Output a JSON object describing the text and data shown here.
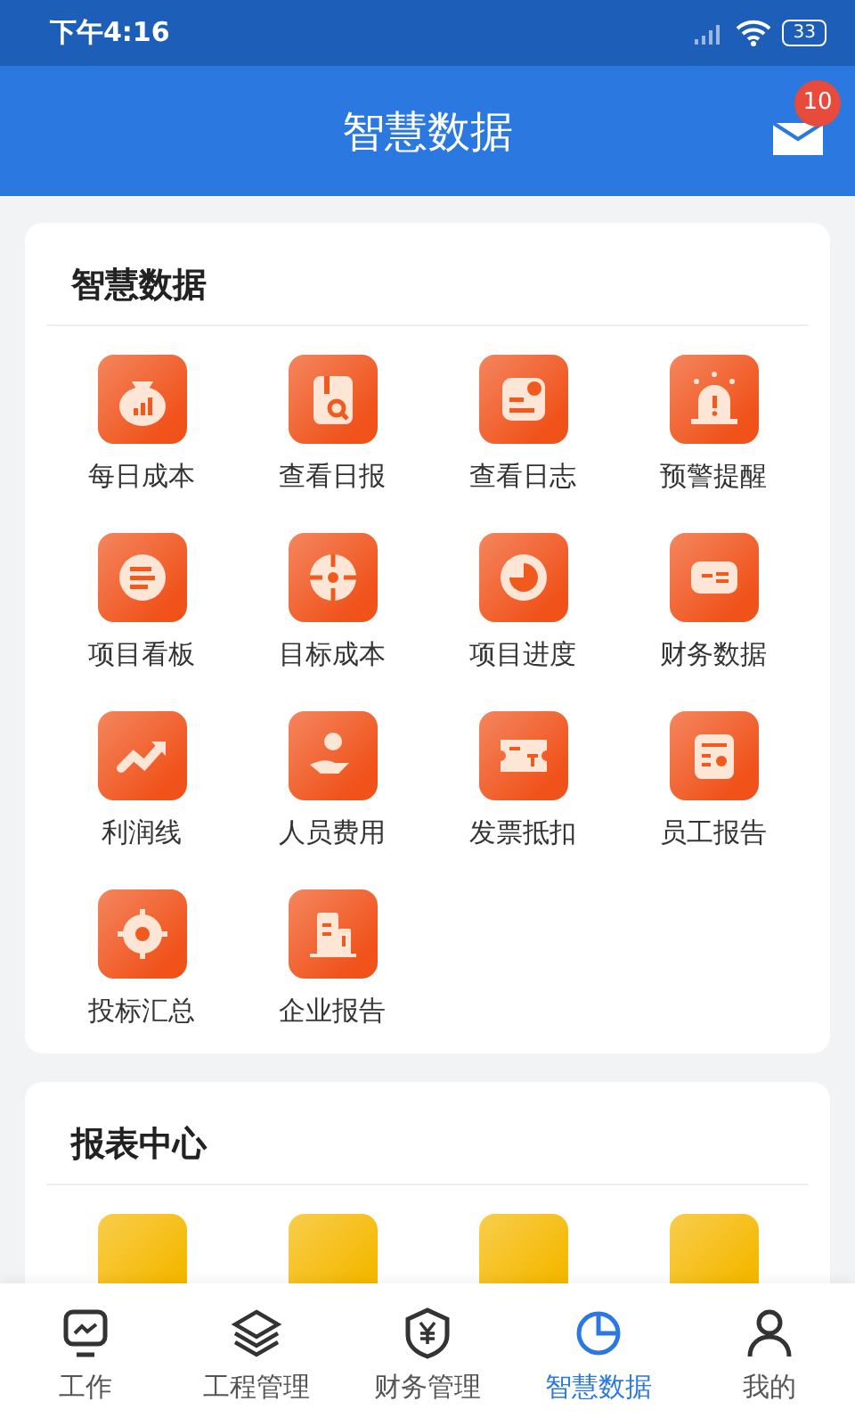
{
  "status_bar": {
    "time": "下午4:16",
    "battery": "33"
  },
  "header": {
    "title": "智慧数据",
    "badge": "10"
  },
  "sections": [
    {
      "title": "智慧数据",
      "color": "#f0521a",
      "items": [
        {
          "label": "每日成本",
          "kind": "money-bag"
        },
        {
          "label": "查看日报",
          "kind": "report-search"
        },
        {
          "label": "查看日志",
          "kind": "log"
        },
        {
          "label": "预警提醒",
          "kind": "alarm"
        },
        {
          "label": "项目看板",
          "kind": "list"
        },
        {
          "label": "目标成本",
          "kind": "target"
        },
        {
          "label": "项目进度",
          "kind": "progress"
        },
        {
          "label": "财务数据",
          "kind": "finance"
        },
        {
          "label": "利润线",
          "kind": "trend"
        },
        {
          "label": "人员费用",
          "kind": "hand-coin"
        },
        {
          "label": "发票抵扣",
          "kind": "invoice"
        },
        {
          "label": "员工报告",
          "kind": "id-card"
        },
        {
          "label": "投标汇总",
          "kind": "location"
        },
        {
          "label": "企业报告",
          "kind": "building"
        }
      ]
    },
    {
      "title": "报表中心",
      "color": "#f5b800",
      "items": [
        {
          "kind": "tile"
        },
        {
          "kind": "tile"
        },
        {
          "kind": "tile"
        },
        {
          "kind": "tile"
        }
      ]
    }
  ],
  "tabs": [
    {
      "label": "工作",
      "kind": "monitor",
      "selected": false
    },
    {
      "label": "工程管理",
      "kind": "layers",
      "selected": false
    },
    {
      "label": "财务管理",
      "kind": "shield",
      "selected": false
    },
    {
      "label": "智慧数据",
      "kind": "data",
      "selected": true
    },
    {
      "label": "我的",
      "kind": "person",
      "selected": false
    }
  ]
}
